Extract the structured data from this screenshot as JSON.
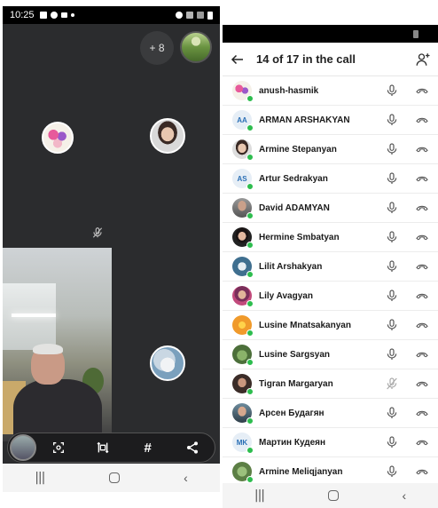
{
  "left_phone": {
    "status_bar": {
      "time": "10:25"
    },
    "overflow_badge": "+ 8",
    "toolbar": {
      "hash_label": "#"
    }
  },
  "right_phone": {
    "header": {
      "title": "14 of 17 in the call"
    },
    "participants": [
      {
        "name": "anush-hasmik",
        "avatar": "photo",
        "muted": false
      },
      {
        "name": "ARMAN ARSHAKYAN",
        "avatar": "initials",
        "initials": "AA",
        "muted": false
      },
      {
        "name": "Armine Stepanyan",
        "avatar": "photo",
        "muted": false
      },
      {
        "name": "Artur Sedrakyan",
        "avatar": "initials",
        "initials": "AS",
        "muted": false
      },
      {
        "name": "David ADAMYAN",
        "avatar": "photo",
        "muted": false
      },
      {
        "name": "Hermine Smbatyan",
        "avatar": "photo",
        "muted": false
      },
      {
        "name": "Lilit Arshakyan",
        "avatar": "photo",
        "muted": false
      },
      {
        "name": "Lily Avagyan",
        "avatar": "photo",
        "muted": false
      },
      {
        "name": "Lusine Mnatsakanyan",
        "avatar": "photo",
        "muted": false
      },
      {
        "name": "Lusine Sargsyan",
        "avatar": "photo",
        "muted": false
      },
      {
        "name": "Tigran Margaryan",
        "avatar": "photo",
        "muted": true
      },
      {
        "name": "Арсен Будагян",
        "avatar": "photo",
        "muted": false
      },
      {
        "name": "Мартин Кудеян",
        "avatar": "initials",
        "initials": "MK",
        "muted": false
      },
      {
        "name": "Armine Meliqjanyan",
        "avatar": "photo",
        "muted": false
      }
    ]
  },
  "colors": {
    "presence": "#2dbd4e",
    "initials_text": "#2a6fb5",
    "initials_bg": "#e6eef6",
    "call_bg": "#2b2c2e"
  },
  "icons": {
    "mic": "microphone-icon",
    "mic_muted": "microphone-muted-icon",
    "hangup": "hang-up-icon",
    "back": "back-arrow-icon",
    "add_person": "add-person-icon"
  }
}
